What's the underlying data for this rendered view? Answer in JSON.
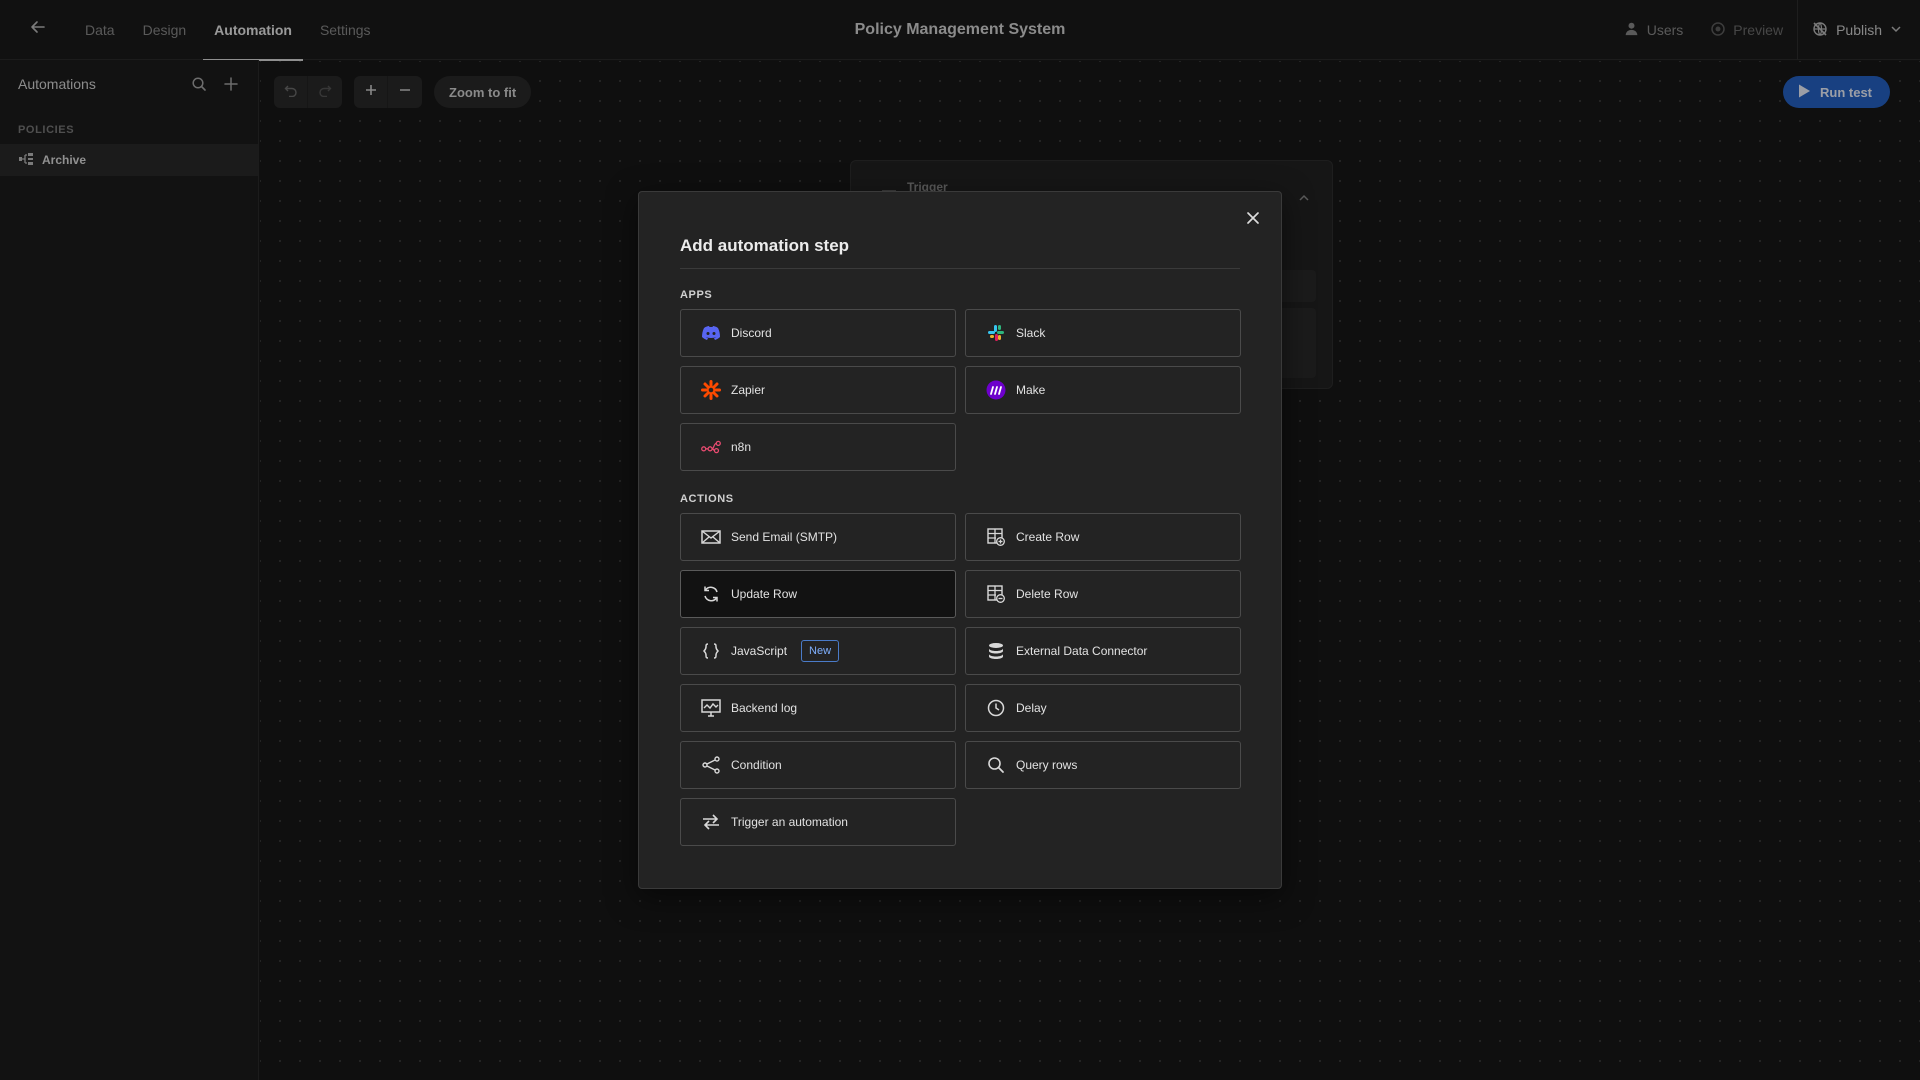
{
  "topbar": {
    "back_icon": "arrow-left-icon",
    "tabs": [
      {
        "label": "Data",
        "active": false
      },
      {
        "label": "Design",
        "active": false
      },
      {
        "label": "Automation",
        "active": true
      },
      {
        "label": "Settings",
        "active": false
      }
    ],
    "title": "Policy Management System",
    "users_label": "Users",
    "preview_label": "Preview",
    "publish_label": "Publish"
  },
  "sidebar": {
    "title": "Automations",
    "section": "POLICIES",
    "items": [
      {
        "label": "Archive",
        "icon": "automation-flow-icon"
      }
    ]
  },
  "canvas": {
    "zoom_to_fit_label": "Zoom to fit",
    "run_test_label": "Run test",
    "trigger_label": "Trigger"
  },
  "modal": {
    "title": "Add automation step",
    "apps_label": "APPS",
    "actions_label": "ACTIONS",
    "apps": [
      {
        "label": "Discord",
        "icon": "discord-icon"
      },
      {
        "label": "Slack",
        "icon": "slack-icon"
      },
      {
        "label": "Zapier",
        "icon": "zapier-icon"
      },
      {
        "label": "Make",
        "icon": "make-icon"
      },
      {
        "label": "n8n",
        "icon": "n8n-icon"
      }
    ],
    "actions": [
      {
        "label": "Send Email (SMTP)",
        "icon": "mail-icon"
      },
      {
        "label": "Create Row",
        "icon": "table-add-icon"
      },
      {
        "label": "Update Row",
        "icon": "refresh-icon",
        "selected": true
      },
      {
        "label": "Delete Row",
        "icon": "table-remove-icon"
      },
      {
        "label": "JavaScript",
        "icon": "braces-icon",
        "badge": "New"
      },
      {
        "label": "External Data Connector",
        "icon": "database-icon"
      },
      {
        "label": "Backend log",
        "icon": "monitor-icon"
      },
      {
        "label": "Delay",
        "icon": "clock-icon"
      },
      {
        "label": "Condition",
        "icon": "branch-icon"
      },
      {
        "label": "Query rows",
        "icon": "search-icon"
      },
      {
        "label": "Trigger an automation",
        "icon": "arrows-swap-icon"
      }
    ],
    "colors": {
      "accent": "#2563c7",
      "badge": "#7fb0ff",
      "discord": "#5865f2",
      "zapier": "#ff4a00",
      "make": "#6d00cc",
      "n8n": "#ea4b71"
    }
  }
}
